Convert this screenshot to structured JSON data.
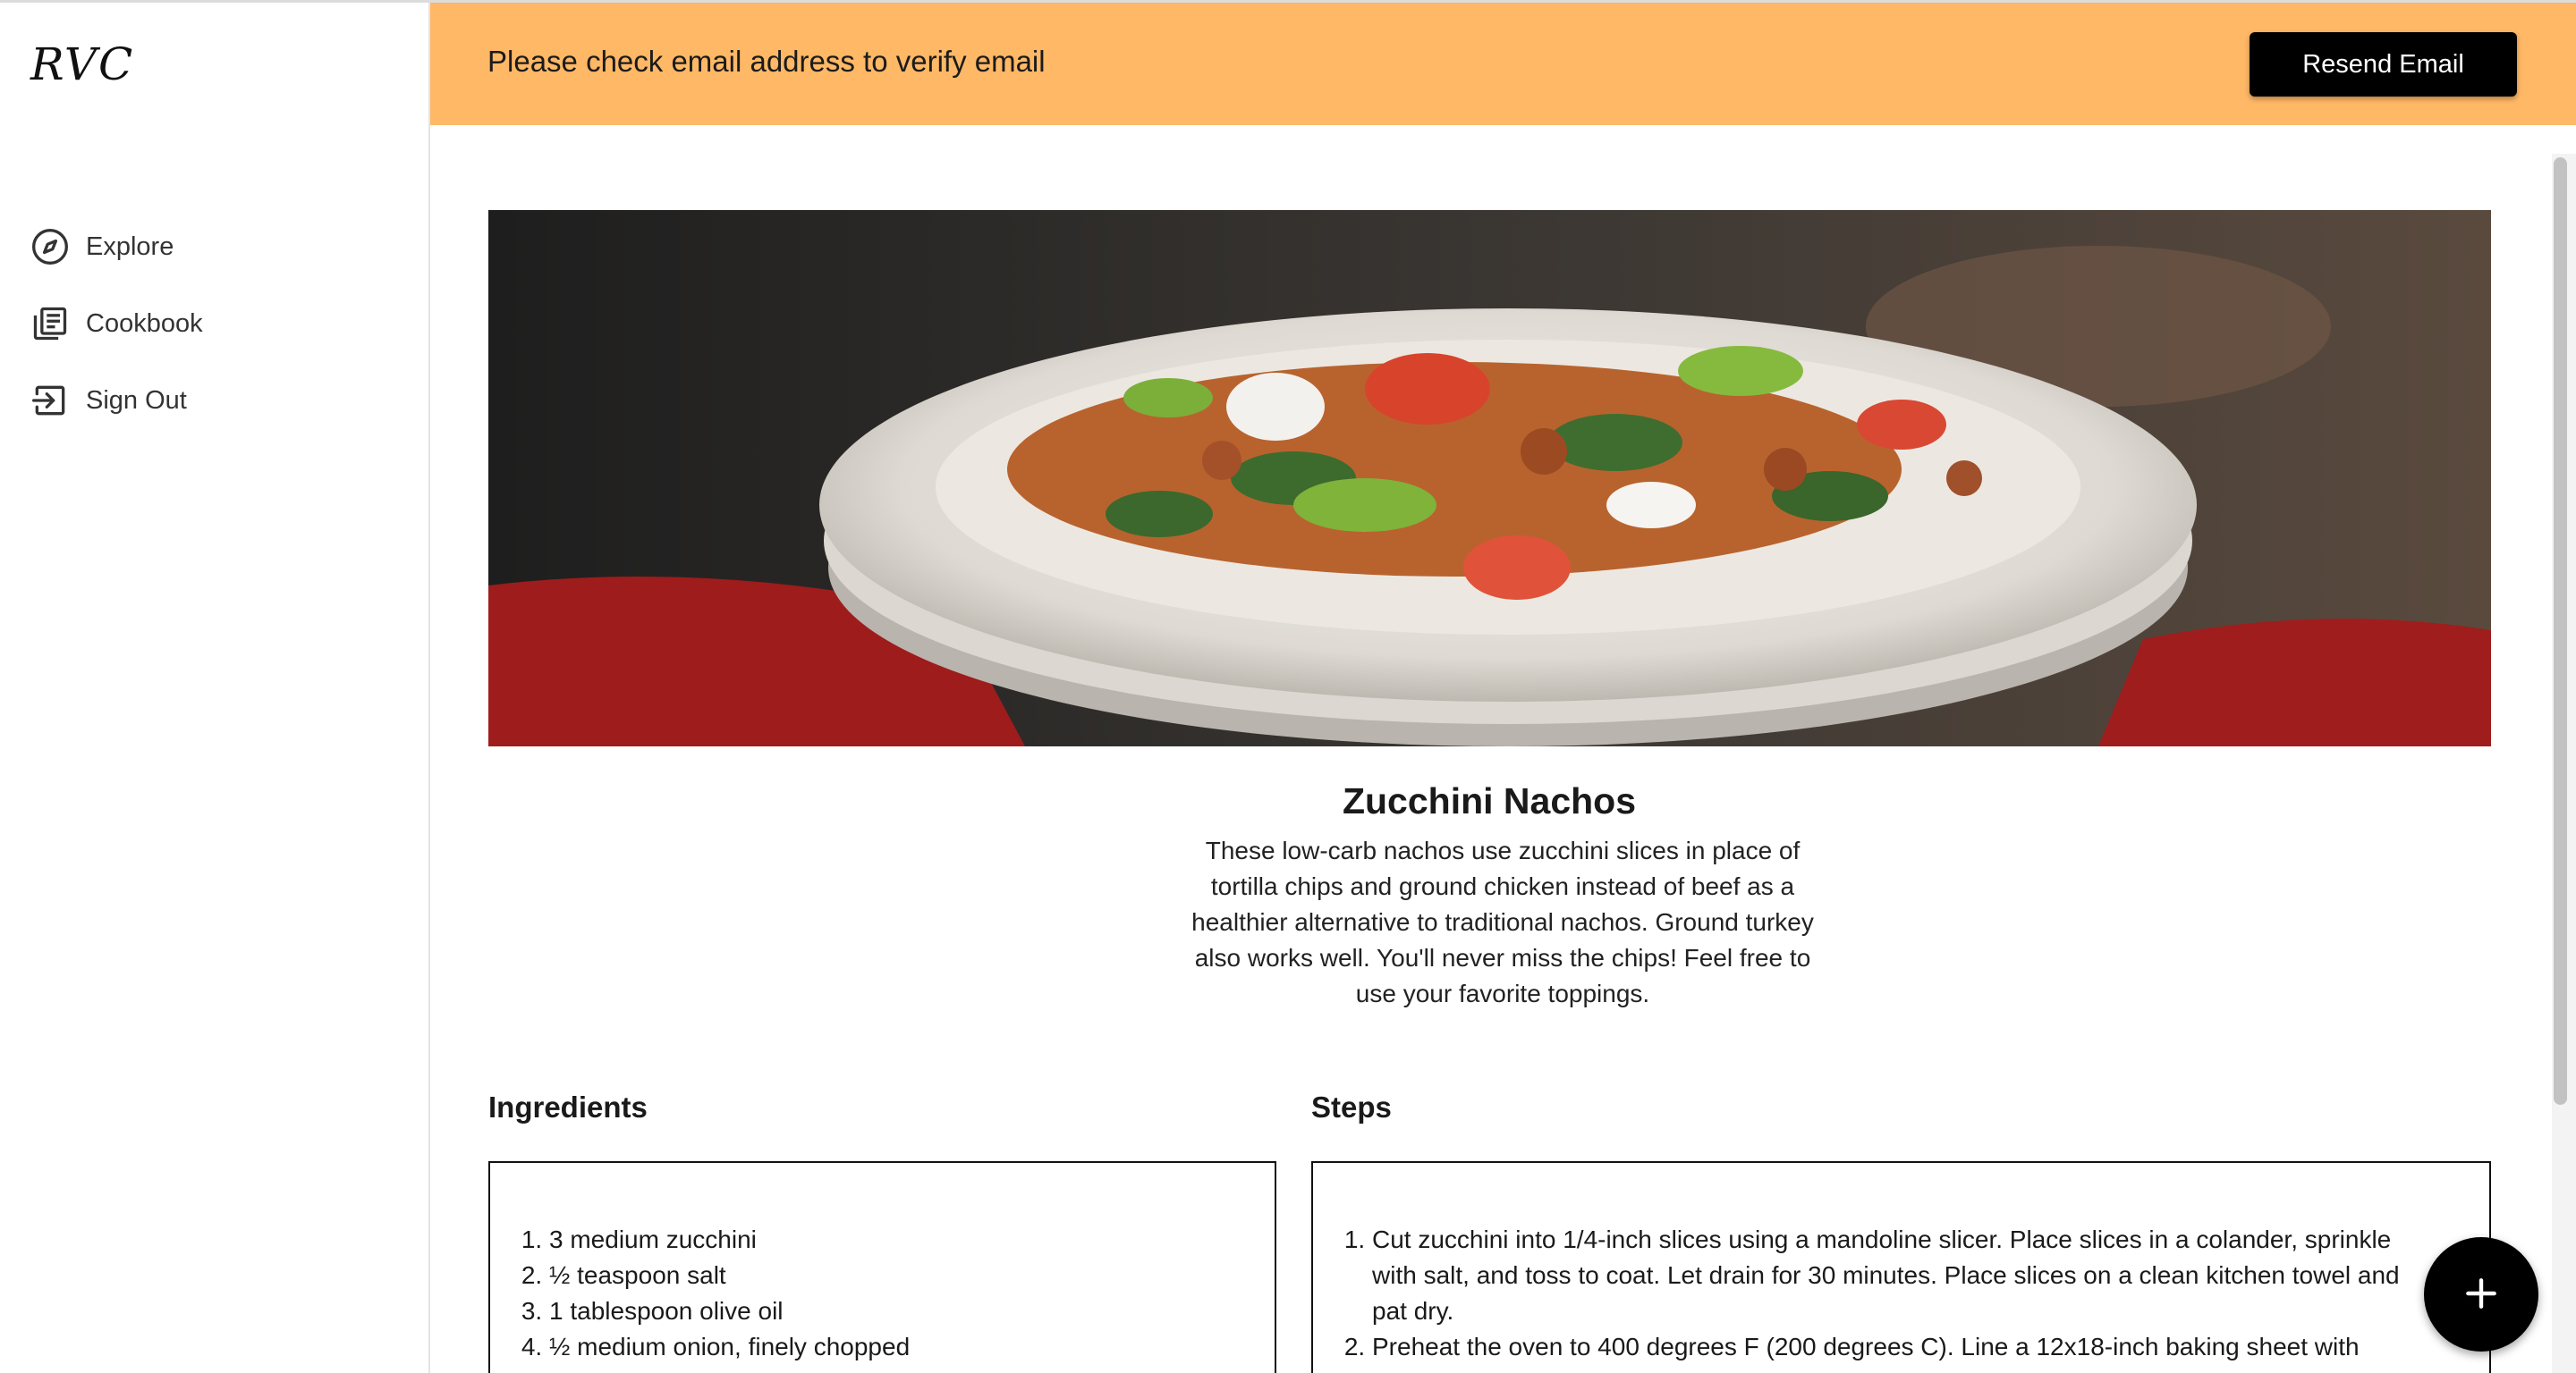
{
  "app": {
    "logo_text": "RVC"
  },
  "sidebar": {
    "items": [
      {
        "label": "Explore",
        "icon": "compass-icon"
      },
      {
        "label": "Cookbook",
        "icon": "book-icon"
      },
      {
        "label": "Sign Out",
        "icon": "sign-out-icon"
      }
    ]
  },
  "banner": {
    "message": "Please check email address to verify email",
    "button_label": "Resend Email",
    "color": "#ffb866"
  },
  "recipe": {
    "image_alt": "Zucchini nachos on a white plate",
    "title": "Zucchini Nachos",
    "description": "These low-carb nachos use zucchini slices in place of tortilla chips and ground chicken instead of beef as a healthier alternative to traditional nachos. Ground turkey also works well. You'll never miss the chips! Feel free to use your favorite toppings.",
    "ingredients_heading": "Ingredients",
    "ingredients": [
      "3 medium zucchini",
      "½ teaspoon salt",
      "1 tablespoon olive oil",
      "½ medium onion, finely chopped"
    ],
    "steps_heading": "Steps",
    "steps": [
      "Cut zucchini into 1/4-inch slices using a mandoline slicer. Place slices in a colander, sprinkle with salt, and toss to coat. Let drain for 30 minutes. Place slices on a clean kitchen towel and pat dry.",
      "Preheat the oven to 400 degrees F (200 degrees C). Line a 12x18-inch baking sheet with"
    ]
  },
  "fab": {
    "icon": "plus-icon"
  }
}
